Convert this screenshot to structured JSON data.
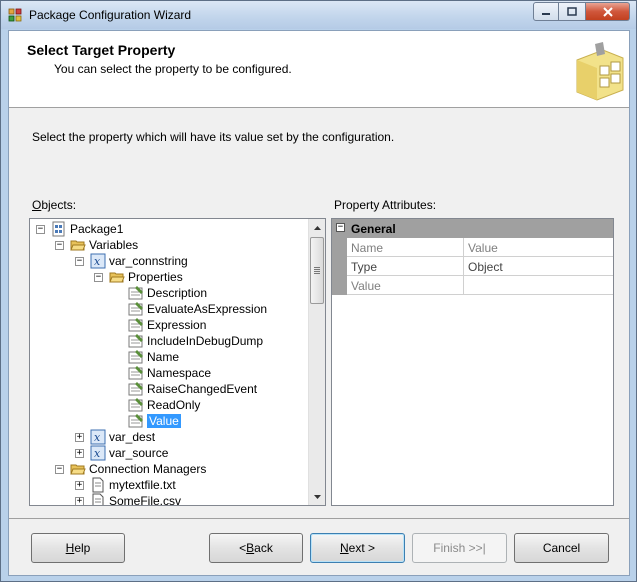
{
  "window": {
    "title": "Package Configuration Wizard"
  },
  "header": {
    "title": "Select Target Property",
    "subtitle": "You can select the property to be configured."
  },
  "instruction": "Select the property which will have its value set by the configuration.",
  "objects_label": "Objects:",
  "property_attributes_label": "Property Attributes:",
  "tree": {
    "package": "Package1",
    "variables": "Variables",
    "var_connstring": "var_connstring",
    "properties": "Properties",
    "props": [
      "Description",
      "EvaluateAsExpression",
      "Expression",
      "IncludeInDebugDump",
      "Name",
      "Namespace",
      "RaiseChangedEvent",
      "ReadOnly",
      "Value"
    ],
    "var_dest": "var_dest",
    "var_source": "var_source",
    "connection_managers": "Connection Managers",
    "mytextfile": "mytextfile.txt",
    "somefile": "SomeFile.csv"
  },
  "grid": {
    "category": "General",
    "rows": [
      {
        "name": "Name",
        "value": "Value"
      },
      {
        "name": "Type",
        "value": "Object"
      },
      {
        "name": "Value",
        "value": ""
      }
    ]
  },
  "buttons": {
    "help_pre": "",
    "help_u": "H",
    "help_post": "elp",
    "back_pre": "< ",
    "back_u": "B",
    "back_post": "ack",
    "next_pre": "",
    "next_u": "N",
    "next_post": "ext >",
    "finish": "Finish >>|",
    "cancel": "Cancel"
  },
  "colors": {
    "selection": "#3399ff",
    "grid_category": "#a0a0a0"
  },
  "icons": {
    "app": "package-config-icon",
    "header": "wizard-graphic-icon"
  }
}
